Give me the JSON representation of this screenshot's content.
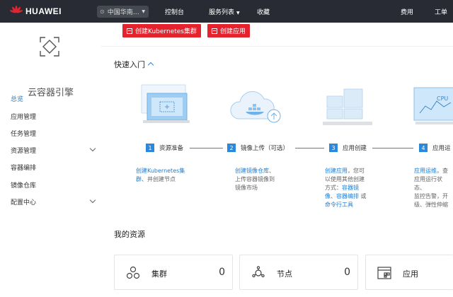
{
  "brand": {
    "name": "HUAWEI",
    "accent": "#e4232f"
  },
  "header": {
    "region": "中国华南…",
    "console": "控制台",
    "services": "服务列表",
    "favorites": "收藏",
    "billing": "费用",
    "tickets": "工单"
  },
  "sidebar": {
    "title": "云容器引擎",
    "items": [
      {
        "label": "总览"
      },
      {
        "label": "应用管理"
      },
      {
        "label": "任务管理"
      },
      {
        "label": "资源管理"
      },
      {
        "label": "容器编排"
      },
      {
        "label": "镜像仓库"
      },
      {
        "label": "配置中心"
      }
    ]
  },
  "actions": {
    "create_cluster": "创建Kubernetes集群",
    "create_app": "创建应用"
  },
  "quickstart": {
    "title": "快速入门",
    "steps": [
      {
        "num": "1",
        "label": "资源准备",
        "link": "创建Kubernetes集群",
        "text": "、并创建节点"
      },
      {
        "num": "2",
        "label": "镜像上传（可选）",
        "link": "创建镜像仓库",
        "text1": "、",
        "text2": "上传容器镜像到",
        "text3": "镜像市场"
      },
      {
        "num": "3",
        "label": "应用创建",
        "link1": "创建应用",
        "text1": "，您可",
        "text2": "以使用其他创建",
        "text3": "方式：",
        "link2": "容器镜",
        "link3": "像",
        "sep": "、",
        "link4": "容器编排",
        "text4": " 或",
        "link5": "命令行工具"
      },
      {
        "num": "4",
        "label": "应用运",
        "link": "应用运维",
        "text1": "。查",
        "text2": "应用运行状态、",
        "text3": "监控告警，开",
        "text4": "级、弹性伸缩"
      }
    ]
  },
  "resources": {
    "title": "我的资源",
    "cards": [
      {
        "label": "集群",
        "count": "0"
      },
      {
        "label": "节点",
        "count": "0"
      },
      {
        "label": "应用"
      }
    ]
  }
}
